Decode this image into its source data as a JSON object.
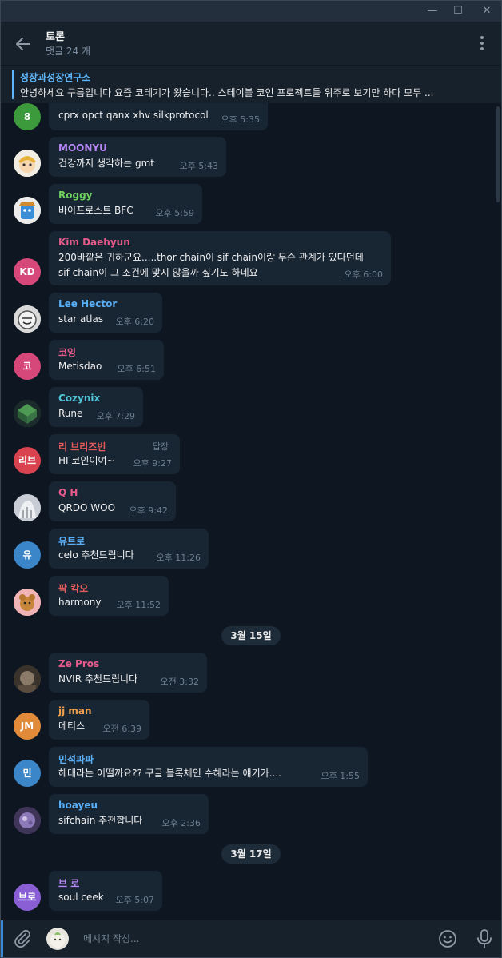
{
  "window": {
    "minimize": "—",
    "maximize": "☐",
    "close": "✕"
  },
  "header": {
    "title": "토론",
    "subtitle": "댓글 24 개"
  },
  "pinned": {
    "title": "성장과성장연구소",
    "text": "안녕하세요 구름입니다  요즘 코테기가 왔습니다.. 스테이블 코인 프로젝트들 위주로 보기만 하다 모두 ..."
  },
  "messages": [
    {
      "initials": "8",
      "color": "#3c9a3c",
      "sender": "",
      "sender_color": "#6fcf5f",
      "lines": [
        "cprx opct qanx xhv silkprotocol"
      ],
      "time": "오후 5:35"
    },
    {
      "initials": "",
      "color": "#e9e9e9",
      "sender": "MOONYU",
      "sender_color": "#b787f7",
      "lines": [
        "건강까지 생각하는 gmt"
      ],
      "time": "오후 5:43"
    },
    {
      "initials": "",
      "color": "#e9e9e9",
      "sender": "Roggy",
      "sender_color": "#6fcf5f",
      "lines": [
        "바이프로스트 BFC"
      ],
      "time": "오후 5:59"
    },
    {
      "initials": "KD",
      "color": "#d6487a",
      "sender": "Kim Daehyun",
      "sender_color": "#e65b8b",
      "lines": [
        "200바깥은 귀하군요.....thor chain이 sif chain이랑 무슨 관계가 있다던데",
        "sif chain이 그 조건에 맞지 않을까 싶기도 하네요"
      ],
      "time": "오후 6:00"
    },
    {
      "initials": "",
      "color": "#d8d8d8",
      "sender": "Lee Hector",
      "sender_color": "#5aaef5",
      "lines": [
        "star atlas"
      ],
      "time": "오후 6:20"
    },
    {
      "initials": "코",
      "color": "#d6487a",
      "sender": "코잉",
      "sender_color": "#e65b8b",
      "lines": [
        "Metisdao"
      ],
      "time": "오후 6:51"
    },
    {
      "initials": "",
      "color": "#2f5a45",
      "sender": "Cozynix",
      "sender_color": "#4fc7d8",
      "lines": [
        "Rune"
      ],
      "time": "오후 7:29"
    },
    {
      "initials": "리브",
      "color": "#d8434f",
      "sender": "리 브리즈번",
      "sender_color": "#e65b5b",
      "lines": [
        "HI 코인이여~"
      ],
      "time": "오후 9:27",
      "reply": "답장"
    },
    {
      "initials": "",
      "color": "#cfd2d8",
      "sender": "Q H",
      "sender_color": "#e65b8b",
      "lines": [
        "QRDO WOO"
      ],
      "time": "오후 9:42"
    },
    {
      "initials": "유",
      "color": "#3b86c8",
      "sender": "유트로",
      "sender_color": "#5aaef5",
      "lines": [
        "celo 추천드립니다"
      ],
      "time": "오후 11:26"
    },
    {
      "initials": "",
      "color": "#e07b80",
      "sender": "팍 칵오",
      "sender_color": "#e65b5b",
      "lines": [
        "harmony"
      ],
      "time": "오후 11:52"
    },
    {
      "date": "3월 15일"
    },
    {
      "initials": "",
      "color": "#4a4036",
      "sender": "Ze Pros",
      "sender_color": "#e65b8b",
      "lines": [
        "NVIR 추천드립니다"
      ],
      "time": "오전 3:32"
    },
    {
      "initials": "JM",
      "color": "#e08a3a",
      "sender": "jj man",
      "sender_color": "#f0a04a",
      "lines": [
        "메티스"
      ],
      "time": "오전 6:39"
    },
    {
      "initials": "민",
      "color": "#3b86c8",
      "sender": "민석파파",
      "sender_color": "#5aaef5",
      "lines": [
        "헤데라는 어떨까요?? 구글 블록체인 수혜라는 얘기가...."
      ],
      "time": "오후 1:55"
    },
    {
      "initials": "",
      "color": "#5a4a7a",
      "sender": "hoayeu",
      "sender_color": "#5aaef5",
      "lines": [
        "sifchain 추천합니다"
      ],
      "time": "오후 2:36"
    },
    {
      "date": "3월 17일"
    },
    {
      "initials": "브로",
      "color": "#8a5fd6",
      "sender": "브 로",
      "sender_color": "#b787f7",
      "lines": [
        "soul ceek"
      ],
      "time": "오후 5:07"
    }
  ],
  "input": {
    "placeholder": "메시지 작성..."
  },
  "icons": {
    "back": "arrow-left-icon",
    "more": "more-vertical-icon",
    "attach": "paperclip-icon",
    "emoji": "smile-icon",
    "mic": "microphone-icon"
  }
}
